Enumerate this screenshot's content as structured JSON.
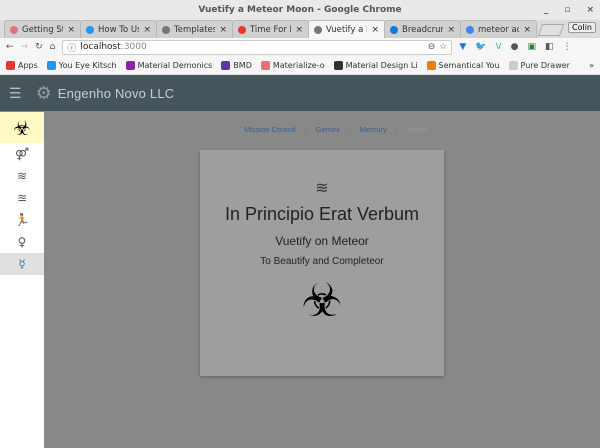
{
  "window": {
    "title": "Vuetify a Meteor Moon - Google Chrome",
    "controls": [
      "_",
      "▫",
      "×"
    ]
  },
  "tabs": [
    {
      "label": "Getting Started",
      "icon": "#e57373"
    },
    {
      "label": "How To Use",
      "icon": "#2196f3"
    },
    {
      "label": "Templates",
      "icon": "#777"
    },
    {
      "label": "Time For New",
      "icon": "#e53935"
    },
    {
      "label": "Vuetify a Meteor",
      "icon": "#777"
    },
    {
      "label": "Breadcrumbs",
      "icon": "#1976d2"
    },
    {
      "label": "meteor add",
      "icon": "#4285f4"
    }
  ],
  "active_tab": 4,
  "profile": "Colin",
  "address": {
    "host": "localhost",
    "port": ":3000"
  },
  "bookmarks": [
    {
      "label": "Apps",
      "color": "#e53935"
    },
    {
      "label": "You Eye Kitsch",
      "color": "#2196f3"
    },
    {
      "label": "Material Demonics",
      "color": "#8e24aa"
    },
    {
      "label": "BMD",
      "color": "#5e35b1"
    },
    {
      "label": "Materialize-o",
      "color": "#ee6e73"
    },
    {
      "label": "Material Design Li",
      "color": "#333"
    },
    {
      "label": "Semantical You",
      "color": "#f57c00"
    },
    {
      "label": "Pure Drawer",
      "color": "#ccc"
    }
  ],
  "bookmarks_more": "»",
  "app": {
    "brand": "Engenho Novo LLC"
  },
  "sidebar": [
    {
      "icon": "biohazard-icon",
      "glyph": "☣"
    },
    {
      "icon": "gender-icon",
      "glyph": "⚤"
    },
    {
      "icon": "water-icon",
      "glyph": "≋"
    },
    {
      "icon": "swimming-icon",
      "glyph": "≊"
    },
    {
      "icon": "running-icon",
      "glyph": "🏃"
    },
    {
      "icon": "venus-icon",
      "glyph": "♀"
    },
    {
      "icon": "mercury-icon",
      "glyph": "☿"
    }
  ],
  "breadcrumbs": [
    "Mission Control",
    "Gemini",
    "Mercury",
    "Apollo"
  ],
  "card": {
    "title": "In Principio Erat Verbum",
    "subtitle": "Vuetify on Meteor",
    "tagline": "To Beautify and Completeor",
    "waves": "≋",
    "bio": "☣"
  }
}
